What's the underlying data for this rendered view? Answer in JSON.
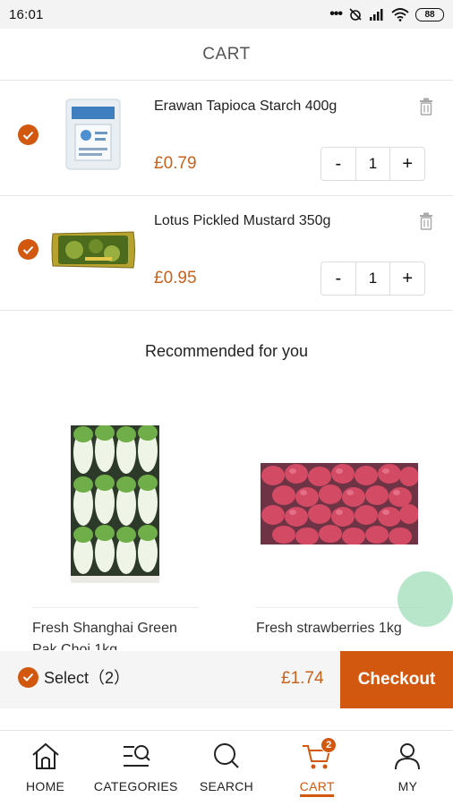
{
  "status_bar": {
    "time": "16:01",
    "battery": "88"
  },
  "header": {
    "title": "CART"
  },
  "cart_items": [
    {
      "name": "Erawan Tapioca Starch 400g",
      "price": "£0.79",
      "quantity": "1",
      "minus": "-",
      "plus": "+"
    },
    {
      "name": "Lotus Pickled Mustard 350g",
      "price": "£0.95",
      "quantity": "1",
      "minus": "-",
      "plus": "+"
    }
  ],
  "recommended": {
    "title": "Recommended for you",
    "products": [
      {
        "name": "Fresh Shanghai Green Pak Choi 1kg"
      },
      {
        "name": "Fresh strawberries 1kg"
      }
    ]
  },
  "checkout": {
    "select_label": "Select（2）",
    "total": "£1.74",
    "button": "Checkout"
  },
  "nav": {
    "items": [
      {
        "label": "HOME",
        "icon": "home-icon"
      },
      {
        "label": "CATEGORIES",
        "icon": "categories-icon"
      },
      {
        "label": "SEARCH",
        "icon": "search-icon"
      },
      {
        "label": "CART",
        "icon": "cart-icon",
        "badge": "2"
      },
      {
        "label": "MY",
        "icon": "user-icon"
      }
    ],
    "active": "CART"
  },
  "colors": {
    "accent": "#d3580f",
    "price": "#c8621c",
    "fab": "#a0deba"
  }
}
